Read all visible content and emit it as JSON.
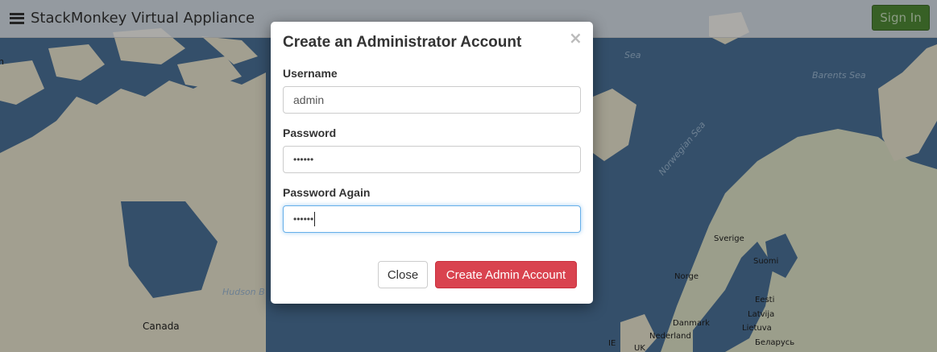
{
  "app": {
    "title": "StackMonkey Virtual Appliance",
    "signin_label": "Sign In"
  },
  "map": {
    "labels": {
      "sea_top": "Sea",
      "barents": "Barents Sea",
      "norwegian": "Norwegian Sea",
      "hudson": "Hudson B",
      "canada": "Canada",
      "sverige": "Sverige",
      "suomi": "Suomi",
      "norge": "Norge",
      "eesti": "Eesti",
      "latvija": "Latvija",
      "lietuva": "Lietuva",
      "danmark": "Danmark",
      "nederland": "Nederland",
      "belarus": "Беларусь",
      "uk": "UK",
      "ie": "IE",
      "left_n": "n"
    }
  },
  "modal": {
    "title": "Create an Administrator Account",
    "close_symbol": "×",
    "username_label": "Username",
    "username_value": "admin",
    "password_label": "Password",
    "password_value": "••••••",
    "password_again_label": "Password Again",
    "password_again_value": "••••••",
    "close_button": "Close",
    "create_button": "Create Admin Account"
  },
  "colors": {
    "create_button": "#d9434f",
    "signin_button": "#4f8a35",
    "map_water": "#4b7299"
  }
}
